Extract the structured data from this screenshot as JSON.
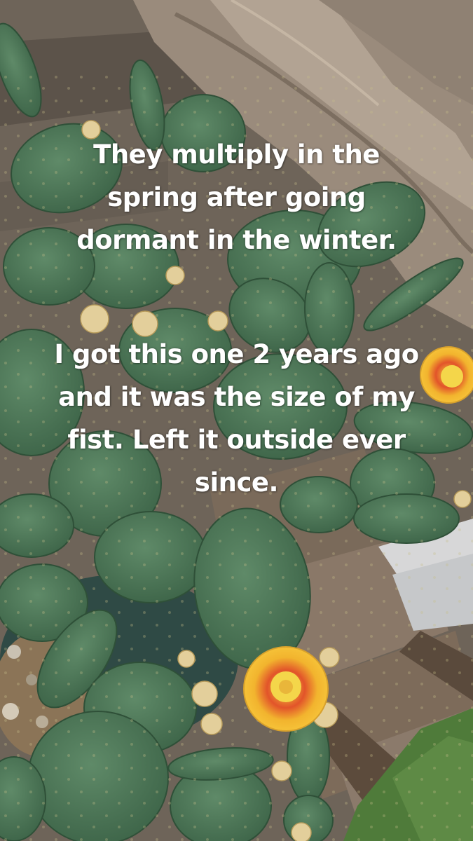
{
  "caption_block_1": {
    "lines": [
      "They multiply in the",
      "spring after going",
      "dormant in the winter."
    ]
  },
  "caption_block_2": {
    "lines": [
      "I got this one 2 years ago",
      "and it was the size of my",
      "fist. Left it outside ever",
      "since."
    ]
  }
}
